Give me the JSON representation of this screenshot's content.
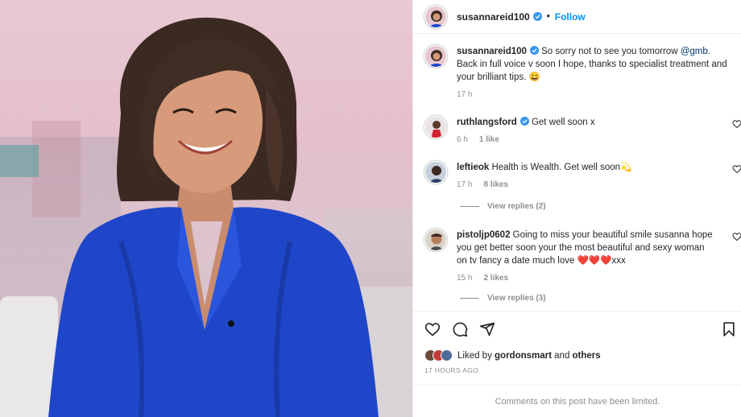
{
  "post": {
    "username": "susannareid100",
    "separator": "•",
    "follow_label": "Follow"
  },
  "caption": {
    "username": "susannareid100",
    "text_before": " So sorry not to see you tomorrow ",
    "mention": "@gmb",
    "text_after": ". Back in full voice v soon I hope, thanks to specialist treatment and your brilliant tips. 😀",
    "time": "17 h"
  },
  "comments": [
    {
      "username": "ruthlangsford",
      "verified": true,
      "text": " Get well soon x",
      "time": "6 h",
      "likes": "1 like"
    },
    {
      "username": "leftieok",
      "verified": false,
      "text": " Health is Wealth. Get well soon💫",
      "time": "17 h",
      "likes": "8 likes",
      "replies": "View replies (2)"
    },
    {
      "username": "pistoljp0602",
      "verified": false,
      "text": " Going to miss your beautiful smile susanna hope you get better soon your the most beautiful and sexy woman on tv fancy a date much love ❤️❤️❤️xxx",
      "time": "15 h",
      "likes": "2 likes",
      "replies": "View replies (3)"
    }
  ],
  "likes": {
    "prefix": "Liked by ",
    "user": "gordonsmart",
    "middle": " and ",
    "others": "others"
  },
  "timestamp": "17 HOURS AGO",
  "limited_notice": "Comments on this post have been limited.",
  "colors": {
    "accent": "#0095f6",
    "verified": "#3897f0",
    "muted": "#8e8e8e",
    "dress": "#1f46c8"
  },
  "icons": [
    "verified-icon",
    "heart-icon",
    "comment-icon",
    "share-icon",
    "bookmark-icon"
  ]
}
